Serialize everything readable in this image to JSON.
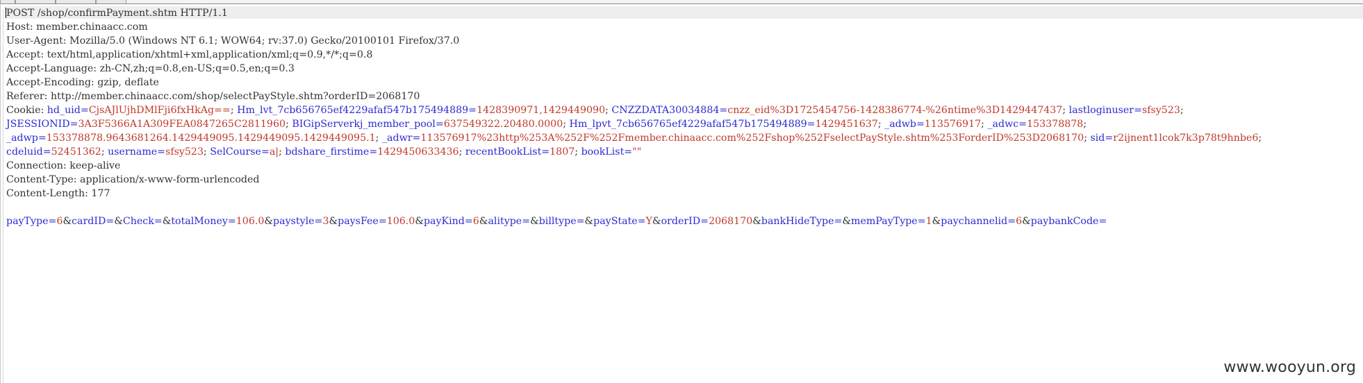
{
  "request_line": "POST /shop/confirmPayment.shtm HTTP/1.1",
  "headers_top": [
    "Host: member.chinaacc.com",
    "User-Agent: Mozilla/5.0 (Windows NT 6.1; WOW64; rv:37.0) Gecko/20100101 Firefox/37.0",
    "Accept: text/html,application/xhtml+xml,application/xml;q=0.9,*/*;q=0.8",
    "Accept-Language: zh-CN,zh;q=0.8,en-US;q=0.5,en;q=0.3",
    "Accept-Encoding: gzip, deflate",
    "Referer: http://member.chinaacc.com/shop/selectPayStyle.shtm?orderID=2068170"
  ],
  "cookie_label": "Cookie: ",
  "cookie_lines": [
    [
      {
        "name": "hd_uid",
        "value": "CjsAJlUjhDMlFji6fxHkAg=="
      },
      {
        "name": "Hm_lvt_7cb656765ef4229afaf547b175494889",
        "value": "1428390971,1429449090"
      },
      {
        "name": "CNZZDATA30034884",
        "value": "cnzz_eid%3D1725454756-1428386774-%26ntime%3D1429447437"
      },
      {
        "name": "lastloginuser",
        "value": "sfsy523"
      }
    ],
    [
      {
        "name": "JSESSIONID",
        "value": "3A3F5366A1A309FEA0847265C2811960"
      },
      {
        "name": "BIGipServerkj_member_pool",
        "value": "637549322.20480.0000"
      },
      {
        "name": "Hm_lpvt_7cb656765ef4229afaf547b175494889",
        "value": "1429451637"
      },
      {
        "name": "_adwb",
        "value": "113576917"
      },
      {
        "name": "_adwc",
        "value": "153378878"
      }
    ],
    [
      {
        "name": "_adwp",
        "value": "153378878.9643681264.1429449095.1429449095.1429449095.1"
      },
      {
        "name": "_adwr",
        "value": "113576917%23http%253A%252F%252Fmember.chinaacc.com%252Fshop%252FselectPayStyle.shtm%253ForderID%253D2068170"
      },
      {
        "name": "sid",
        "value": "r2ijnent1lcok7k3p78t9hnbe6"
      }
    ],
    [
      {
        "name": "cdeluid",
        "value": "52451362"
      },
      {
        "name": "username",
        "value": "sfsy523"
      },
      {
        "name": "SelCourse",
        "value": "a|"
      },
      {
        "name": "bdshare_firstime",
        "value": "1429450633436"
      },
      {
        "name": "recentBookList",
        "value": "1807"
      },
      {
        "name": "bookList",
        "value": "\"\""
      }
    ]
  ],
  "headers_bottom": [
    "Connection: keep-alive",
    "Content-Type: application/x-www-form-urlencoded",
    "Content-Length: 177"
  ],
  "body_params": [
    {
      "name": "payType",
      "value": "6"
    },
    {
      "name": "cardID",
      "value": ""
    },
    {
      "name": "Check",
      "value": ""
    },
    {
      "name": "totalMoney",
      "value": "106.0"
    },
    {
      "name": "paystyle",
      "value": "3"
    },
    {
      "name": "paysFee",
      "value": "106.0"
    },
    {
      "name": "payKind",
      "value": "6"
    },
    {
      "name": "alitype",
      "value": ""
    },
    {
      "name": "billtype",
      "value": ""
    },
    {
      "name": "payState",
      "value": "Y"
    },
    {
      "name": "orderID",
      "value": "2068170"
    },
    {
      "name": "bankHideType",
      "value": ""
    },
    {
      "name": "memPayType",
      "value": "1"
    },
    {
      "name": "paychannelid",
      "value": "6"
    },
    {
      "name": "paybankCode",
      "value": ""
    }
  ],
  "watermark": "www.wooyun.org",
  "colors": {
    "param_name": "#2b2bd0",
    "param_value": "#c0392b",
    "text": "#333333",
    "current_line": "#eeeeee"
  }
}
